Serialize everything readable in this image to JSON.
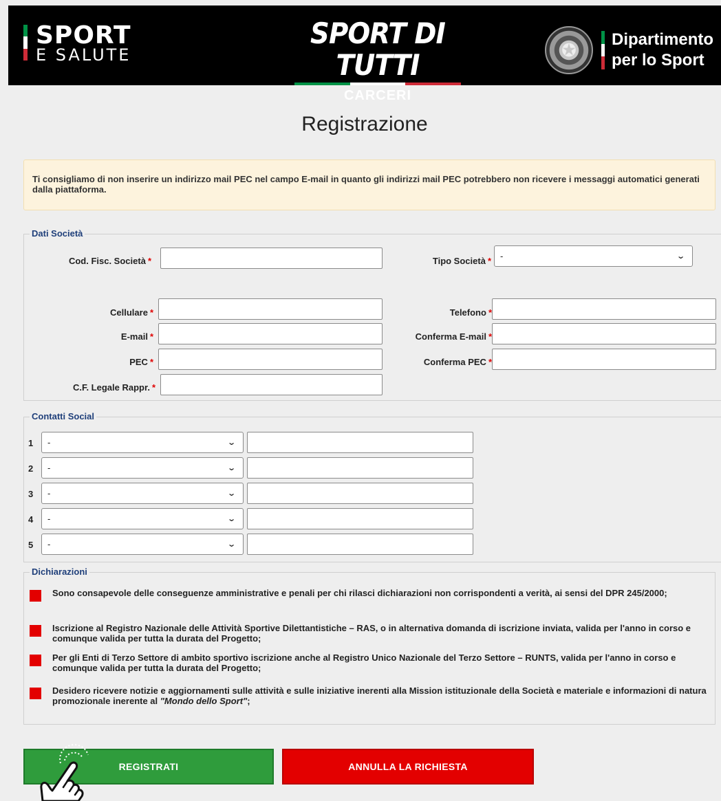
{
  "header": {
    "sport_salute": {
      "main": "SPORT",
      "sub": "E SALUTE"
    },
    "sport_di_tutti": {
      "title": "SPORT DI TUTTI",
      "sub": "CARCERI"
    },
    "dipartimento": {
      "line1": "Dipartimento",
      "line2": "per lo Sport"
    },
    "flag_colors": [
      "#009246",
      "#ffffff",
      "#ce2b37"
    ]
  },
  "page_title": "Registrazione",
  "notice": "Ti consigliamo di non inserire un indirizzo mail PEC nel campo E-mail in quanto gli indirizzi mail PEC potrebbero non ricevere i messaggi automatici generati dalla piattaforma.",
  "dati_societa": {
    "legend": "Dati Società",
    "required_mark": "*",
    "cod_fisc": {
      "label": "Cod. Fisc. Società",
      "value": ""
    },
    "tipo_societa": {
      "label": "Tipo Società",
      "value": "-"
    },
    "cellulare": {
      "label": "Cellulare",
      "value": ""
    },
    "telefono": {
      "label": "Telefono",
      "value": ""
    },
    "email": {
      "label": "E-mail",
      "value": ""
    },
    "conferma_email": {
      "label": "Conferma E-mail",
      "value": ""
    },
    "pec": {
      "label": "PEC",
      "value": ""
    },
    "conferma_pec": {
      "label": "Conferma PEC",
      "value": ""
    },
    "cf_legale": {
      "label": "C.F. Legale Rappr.",
      "value": ""
    }
  },
  "contatti_social": {
    "legend": "Contatti Social",
    "rows": [
      {
        "num": "1",
        "select": "-",
        "value": ""
      },
      {
        "num": "2",
        "select": "-",
        "value": ""
      },
      {
        "num": "3",
        "select": "-",
        "value": ""
      },
      {
        "num": "4",
        "select": "-",
        "value": ""
      },
      {
        "num": "5",
        "select": "-",
        "value": ""
      }
    ]
  },
  "dichiarazioni": {
    "legend": "Dichiarazioni",
    "items": [
      {
        "text": "Sono consapevole delle conseguenze amministrative e penali per chi rilasci dichiarazioni non corrispondenti a verità, ai sensi del DPR 245/2000;"
      },
      {
        "text": "Iscrizione al Registro Nazionale delle Attività Sportive Dilettantistiche – RAS, o in alternativa domanda di iscrizione inviata, valida per l'anno in corso e comunque valida per tutta la durata del Progetto;"
      },
      {
        "text": "Per gli Enti di Terzo Settore di ambito sportivo iscrizione anche al Registro Unico Nazionale del Terzo Settore – RUNTS, valida per l'anno in corso e comunque valida per tutta la durata del Progetto;"
      },
      {
        "text_before": "Desidero ricevere notizie e aggiornamenti sulle attività e sulle iniziative inerenti alla Mission istituzionale della Società e materiale e informazioni di natura promozionale inerente al ",
        "text_italic": "\"Mondo dello Sport\"",
        "text_after": ";"
      }
    ]
  },
  "buttons": {
    "register": "REGISTRATI",
    "cancel": "ANNULLA LA RICHIESTA"
  },
  "colors": {
    "required": "#e00000",
    "legend": "#1f3f7a",
    "checkbox": "#e30000",
    "register_button": "#2f9c3c",
    "cancel_button": "#e30000",
    "notice_bg": "#fdf3dd"
  },
  "icons": {
    "cursor": "pointing-hand-icon",
    "emblem": "italian-republic-emblem-icon",
    "select_arrow": "chevron-down-icon"
  }
}
